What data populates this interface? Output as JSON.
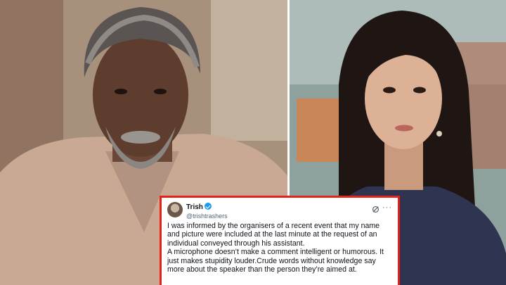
{
  "tweet": {
    "display_name": "Trish",
    "handle": "@trishtrashers",
    "paragraph1": "I was informed by the organisers of a recent event that my name and picture were included at the last minute at the request of an individual conveyed through his assistant.",
    "paragraph2": "A microphone doesn’t make a comment intelligent or humorous. It just makes stupidity louder.Crude words without knowledge say more about the speaker than the person they’re aimed at."
  },
  "icons": {
    "verified": "verified-badge-icon",
    "grok": "grok-icon",
    "more": "more-options-icon"
  },
  "colors": {
    "highlight_border": "#e2231a",
    "verified_blue": "#1d9bf0"
  }
}
